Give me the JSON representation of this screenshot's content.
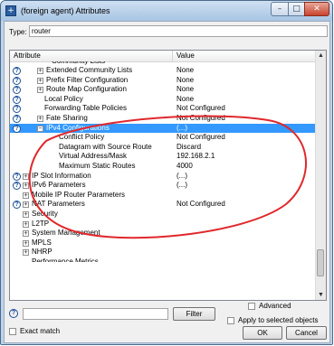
{
  "window": {
    "title": "(foreign agent) Attributes",
    "min_glyph": "–",
    "max_glyph": "□",
    "close_glyph": "✕"
  },
  "type": {
    "label": "Type:",
    "value": "router"
  },
  "grid": {
    "headers": {
      "attribute": "Attribute",
      "value": "Value"
    },
    "cut_row_label": "Community Lists",
    "rows": [
      {
        "label": "Extended Community Lists",
        "value": "None",
        "expander": "+"
      },
      {
        "label": "Prefix Filter Configuration",
        "value": "None",
        "expander": "+"
      },
      {
        "label": "Route Map Configuration",
        "value": "None",
        "expander": "+"
      },
      {
        "label": "Local Policy",
        "value": "None",
        "expander": ""
      },
      {
        "label": "Forwarding Table Policies",
        "value": "Not Configured",
        "expander": ""
      },
      {
        "label": "Fate Sharing",
        "value": "Not Configured",
        "expander": "+"
      },
      {
        "label": "IPv4 Configurations",
        "value": "(...)",
        "expander": "−"
      },
      {
        "label": "Conflict Policy",
        "value": "Not Configured",
        "expander": ""
      },
      {
        "label": "Datagram with Source Route",
        "value": "Discard",
        "expander": ""
      },
      {
        "label": "Virtual Address/Mask",
        "value": "192.168.2.1",
        "expander": ""
      },
      {
        "label": "Maximum Static Routes",
        "value": "4000",
        "expander": ""
      },
      {
        "label": "IP Slot Information",
        "value": "(...)",
        "expander": "+"
      },
      {
        "label": "IPv6 Parameters",
        "value": "(...)",
        "expander": "+"
      },
      {
        "label": "Mobile IP Router Parameters",
        "value": "",
        "expander": "+"
      },
      {
        "label": "NAT Parameters",
        "value": "Not Configured",
        "expander": "+"
      },
      {
        "label": "Security",
        "value": "",
        "expander": "+"
      },
      {
        "label": "L2TP",
        "value": "",
        "expander": "+"
      },
      {
        "label": "System Management",
        "value": "",
        "expander": "+"
      },
      {
        "label": "MPLS",
        "value": "",
        "expander": "+"
      },
      {
        "label": "NHRP",
        "value": "",
        "expander": "+"
      }
    ],
    "cut_bottom_label": "Performance Metrics",
    "scroll_up": "▲",
    "scroll_down": "▼"
  },
  "options": {
    "advanced": "Advanced",
    "apply_selected": "Apply to selected objects",
    "exact_match": "Exact match"
  },
  "buttons": {
    "filter": "Filter",
    "ok": "OK",
    "cancel": "Cancel"
  },
  "help_glyph": "?",
  "annotation": {
    "color": "#e0282c"
  }
}
